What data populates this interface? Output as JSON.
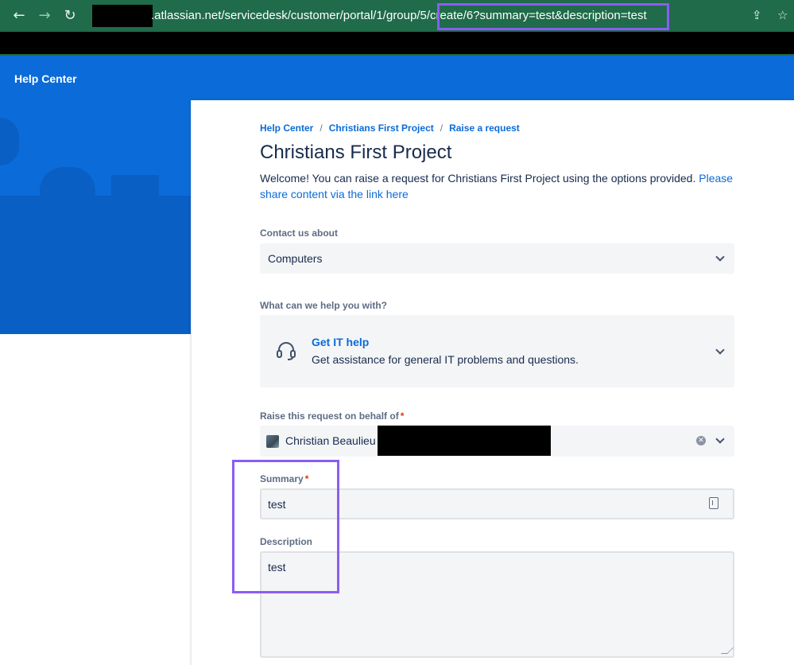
{
  "browser": {
    "back_icon": "arrow-left-icon",
    "forward_icon": "arrow-right-icon",
    "reload_icon": "reload-icon",
    "url": ".atlassian.net/servicedesk/customer/portal/1/group/5/create/6?summary=test&description=test",
    "share_icon": "share-icon",
    "bookmark_icon": "star-icon"
  },
  "banner": {
    "title": "Help Center"
  },
  "breadcrumb": {
    "items": [
      "Help Center",
      "Christians First Project",
      "Raise a request"
    ]
  },
  "page": {
    "title": "Christians First Project",
    "welcome_text": "Welcome! You can raise a request for Christians First Project using the options provided. ",
    "welcome_link": "Please share content via the link here"
  },
  "form": {
    "contact_label": "Contact us about",
    "contact_value": "Computers",
    "help_label": "What can we help you with?",
    "request_type_title": "Get IT help",
    "request_type_desc": "Get assistance for general IT problems and questions.",
    "request_type_icon": "headset-icon",
    "behalf_label": "Raise this request on behalf of",
    "behalf_value": "Christian Beaulieu",
    "summary_label": "Summary",
    "summary_value": "test",
    "description_label": "Description",
    "description_value": "test",
    "required_mark": "*"
  },
  "colors": {
    "brand_blue": "#0b6bd8",
    "browser_green": "#1f6b4a",
    "annotation_purple": "#8b5cf6",
    "required_red": "#de350b"
  }
}
